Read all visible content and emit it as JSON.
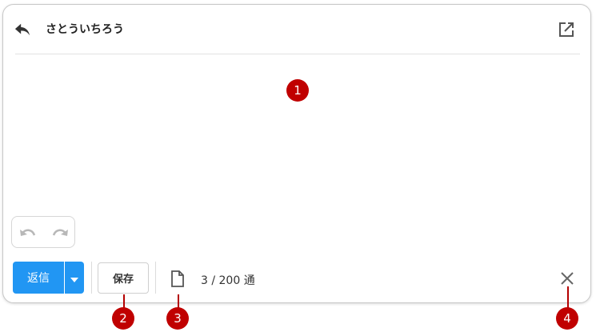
{
  "header": {
    "recipient": "さとういちろう",
    "reply_icon": "reply-arrow-icon",
    "popout_icon": "open-in-new-window-icon"
  },
  "toolbar": {
    "undo_icon": "undo-icon",
    "redo_icon": "redo-icon",
    "reply_label": "返信",
    "reply_dropdown_icon": "caret-down-icon",
    "save_label": "保存",
    "document_icon": "document-icon",
    "counter_text": "3 / 200 通",
    "close_icon": "close-icon"
  },
  "callouts": [
    "1",
    "2",
    "3",
    "4"
  ],
  "colors": {
    "primary": "#2196f3",
    "callout": "#c00000",
    "border": "#c8c8c8"
  }
}
